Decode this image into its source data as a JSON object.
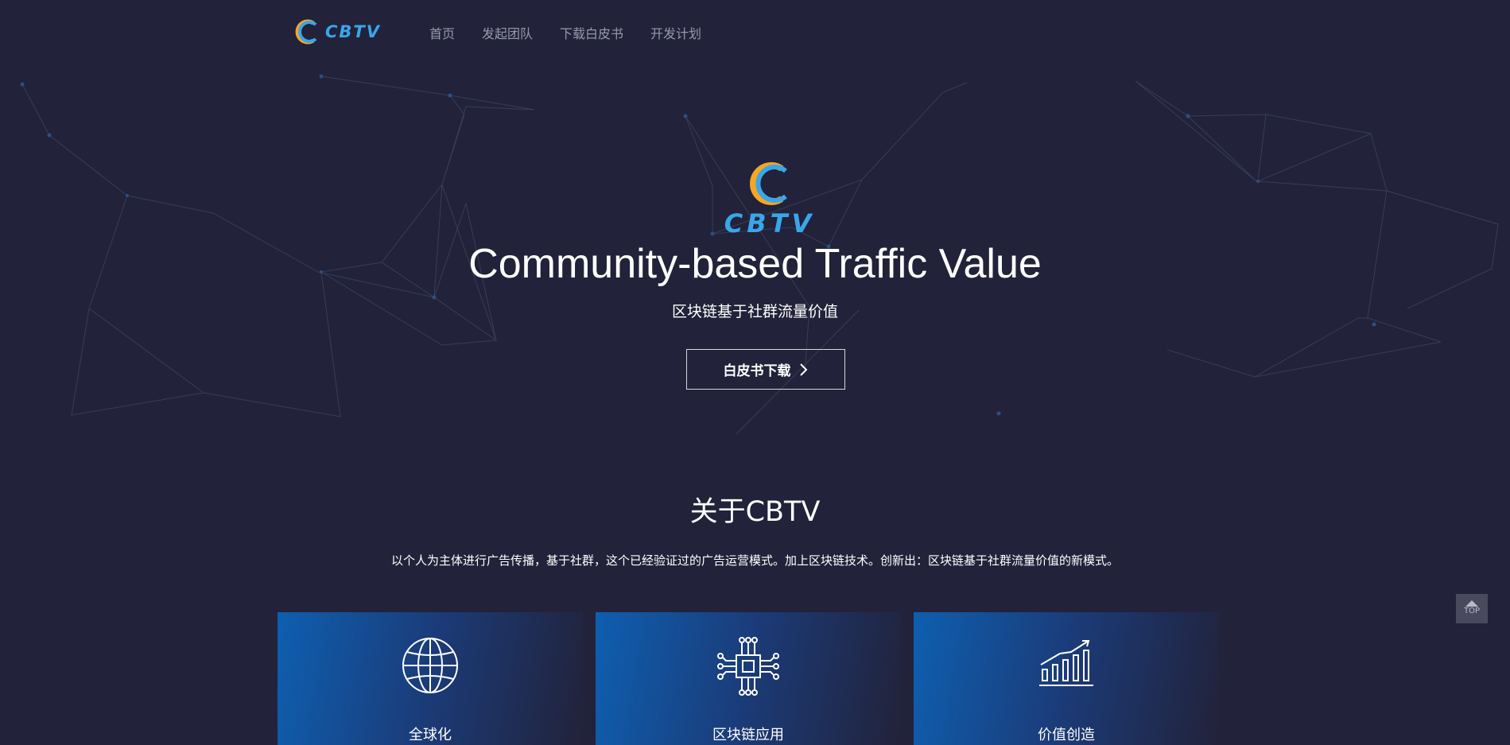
{
  "nav": {
    "logo_text": "CBTV",
    "items": [
      {
        "label": "首页"
      },
      {
        "label": "发起团队"
      },
      {
        "label": "下载白皮书"
      },
      {
        "label": "开发计划"
      }
    ]
  },
  "hero": {
    "logo_text": "CBTV",
    "title": "Community-based Traffic Value",
    "subtitle": "区块链基于社群流量价值",
    "button_label": "白皮书下载"
  },
  "about": {
    "title": "关于CBTV",
    "description": "以个人为主体进行广告传播，基于社群，这个已经验证过的广告运营模式。加上区块链技术。创新出：区块链基于社群流量价值的新模式。"
  },
  "features": [
    {
      "label": "全球化",
      "icon": "globe-icon"
    },
    {
      "label": "区块链应用",
      "icon": "chip-icon"
    },
    {
      "label": "价值创造",
      "icon": "growth-chart-icon"
    }
  ],
  "back_to_top": {
    "label": "TOP"
  },
  "colors": {
    "background": "#22223a",
    "brand_blue": "#3aa6ea",
    "brand_orange": "#f5a623",
    "card_blue": "#0e5fb0"
  }
}
